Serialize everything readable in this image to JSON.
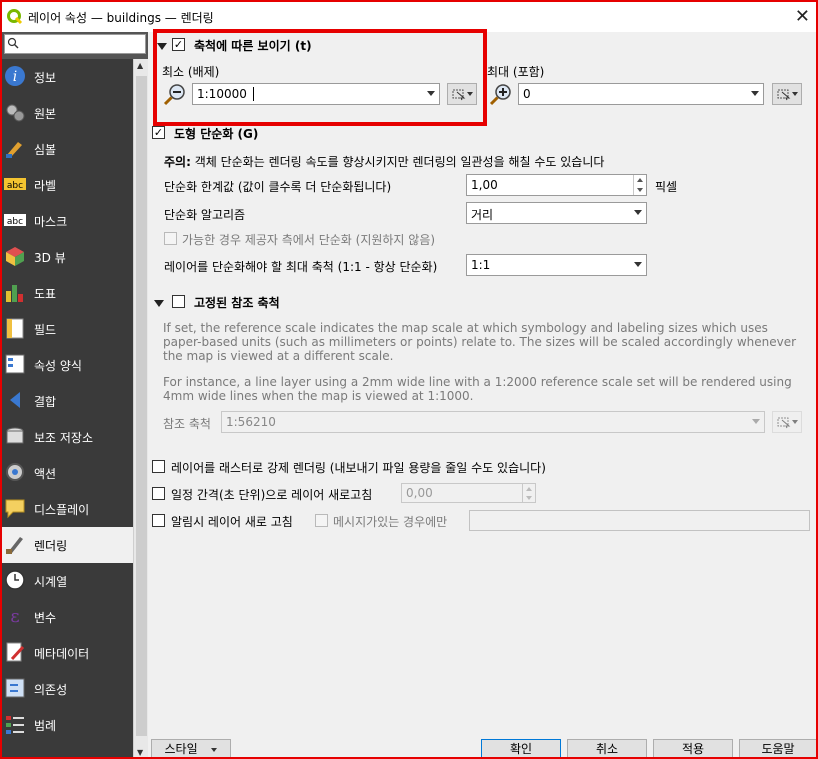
{
  "window": {
    "title": "레이어 속성 — buildings — 렌더링"
  },
  "sidebar": {
    "items": [
      {
        "label": "정보",
        "icon": "info-icon"
      },
      {
        "label": "원본",
        "icon": "source-gears-icon"
      },
      {
        "label": "심볼",
        "icon": "symbology-brush-icon"
      },
      {
        "label": "라벨",
        "icon": "labels-abc-icon"
      },
      {
        "label": "마스크",
        "icon": "mask-abc-icon"
      },
      {
        "label": "3D 뷰",
        "icon": "3d-cube-icon"
      },
      {
        "label": "도표",
        "icon": "diagram-icon"
      },
      {
        "label": "필드",
        "icon": "fields-icon"
      },
      {
        "label": "속성 양식",
        "icon": "attributes-form-icon"
      },
      {
        "label": "결합",
        "icon": "joins-icon"
      },
      {
        "label": "보조 저장소",
        "icon": "auxiliary-storage-icon"
      },
      {
        "label": "액션",
        "icon": "actions-gear-icon"
      },
      {
        "label": "디스플레이",
        "icon": "display-speech-icon"
      },
      {
        "label": "렌더링",
        "icon": "rendering-brush-icon"
      },
      {
        "label": "시계열",
        "icon": "temporal-clock-icon"
      },
      {
        "label": "변수",
        "icon": "variables-epsilon-icon"
      },
      {
        "label": "메타데이터",
        "icon": "metadata-pencil-icon"
      },
      {
        "label": "의존성",
        "icon": "dependencies-icon"
      },
      {
        "label": "범례",
        "icon": "legend-icon"
      }
    ],
    "active_index": 13
  },
  "scale_visibility": {
    "label": "축척에 따른 보이기 (t)",
    "checked": true,
    "min_label": "최소 (배제)",
    "min_value": "1:10000",
    "max_label": "최대 (포함)",
    "max_value": "0"
  },
  "simplify": {
    "label": "도형 단순화 (G)",
    "checked": true,
    "note_bold": "주의:",
    "note": " 객체 단순화는 렌더링 속도를 향상시키지만 렌더링의 일관성을 해칠 수도 있습니다",
    "threshold_label": "단순화 한계값 (값이 클수록 더 단순화됩니다)",
    "threshold_value": "1,00",
    "threshold_unit": "픽셀",
    "algorithm_label": "단순화 알고리즘",
    "algorithm_value": "거리",
    "provider_label": "가능한 경우 제공자 측에서 단순화 (지원하지 않음)",
    "max_scale_label": "레이어를 단순화해야 할 최대 축척 (1:1 - 항상 단순화)",
    "max_scale_value": "1:1"
  },
  "reference_scale": {
    "label": "고정된 참조 축척",
    "checked": false,
    "desc1": "If set, the reference scale indicates the map scale at which symbology and labeling sizes which uses paper-based units (such as millimeters or points) relate to. The sizes will be scaled accordingly whenever the map is viewed at a different scale.",
    "desc2": "For instance, a line layer using a 2mm wide line with a 1:2000 reference scale set will be rendered using 4mm wide lines when the map is viewed at 1:1000.",
    "scale_label": "참조 축척",
    "scale_value": "1:56210"
  },
  "options": {
    "raster_label": "레이어를 래스터로 강제 렌더링 (내보내기 파일 용량을 줄일 수도 있습니다)",
    "refresh_label": "일정 간격(초 단위)으로 레이어 새로고침",
    "refresh_value": "0,00",
    "notify_label": "알림시 레이어 새로 고침",
    "only_message_label": "메시지가있는 경우에만"
  },
  "buttons": {
    "style": "스타일",
    "ok": "확인",
    "cancel": "취소",
    "apply": "적용",
    "help": "도움말"
  },
  "search": {
    "placeholder": ""
  },
  "colors": {
    "highlight": "#e60000",
    "sidebar_bg": "#3a3a3a",
    "active_bg": "#f0f0f0"
  }
}
